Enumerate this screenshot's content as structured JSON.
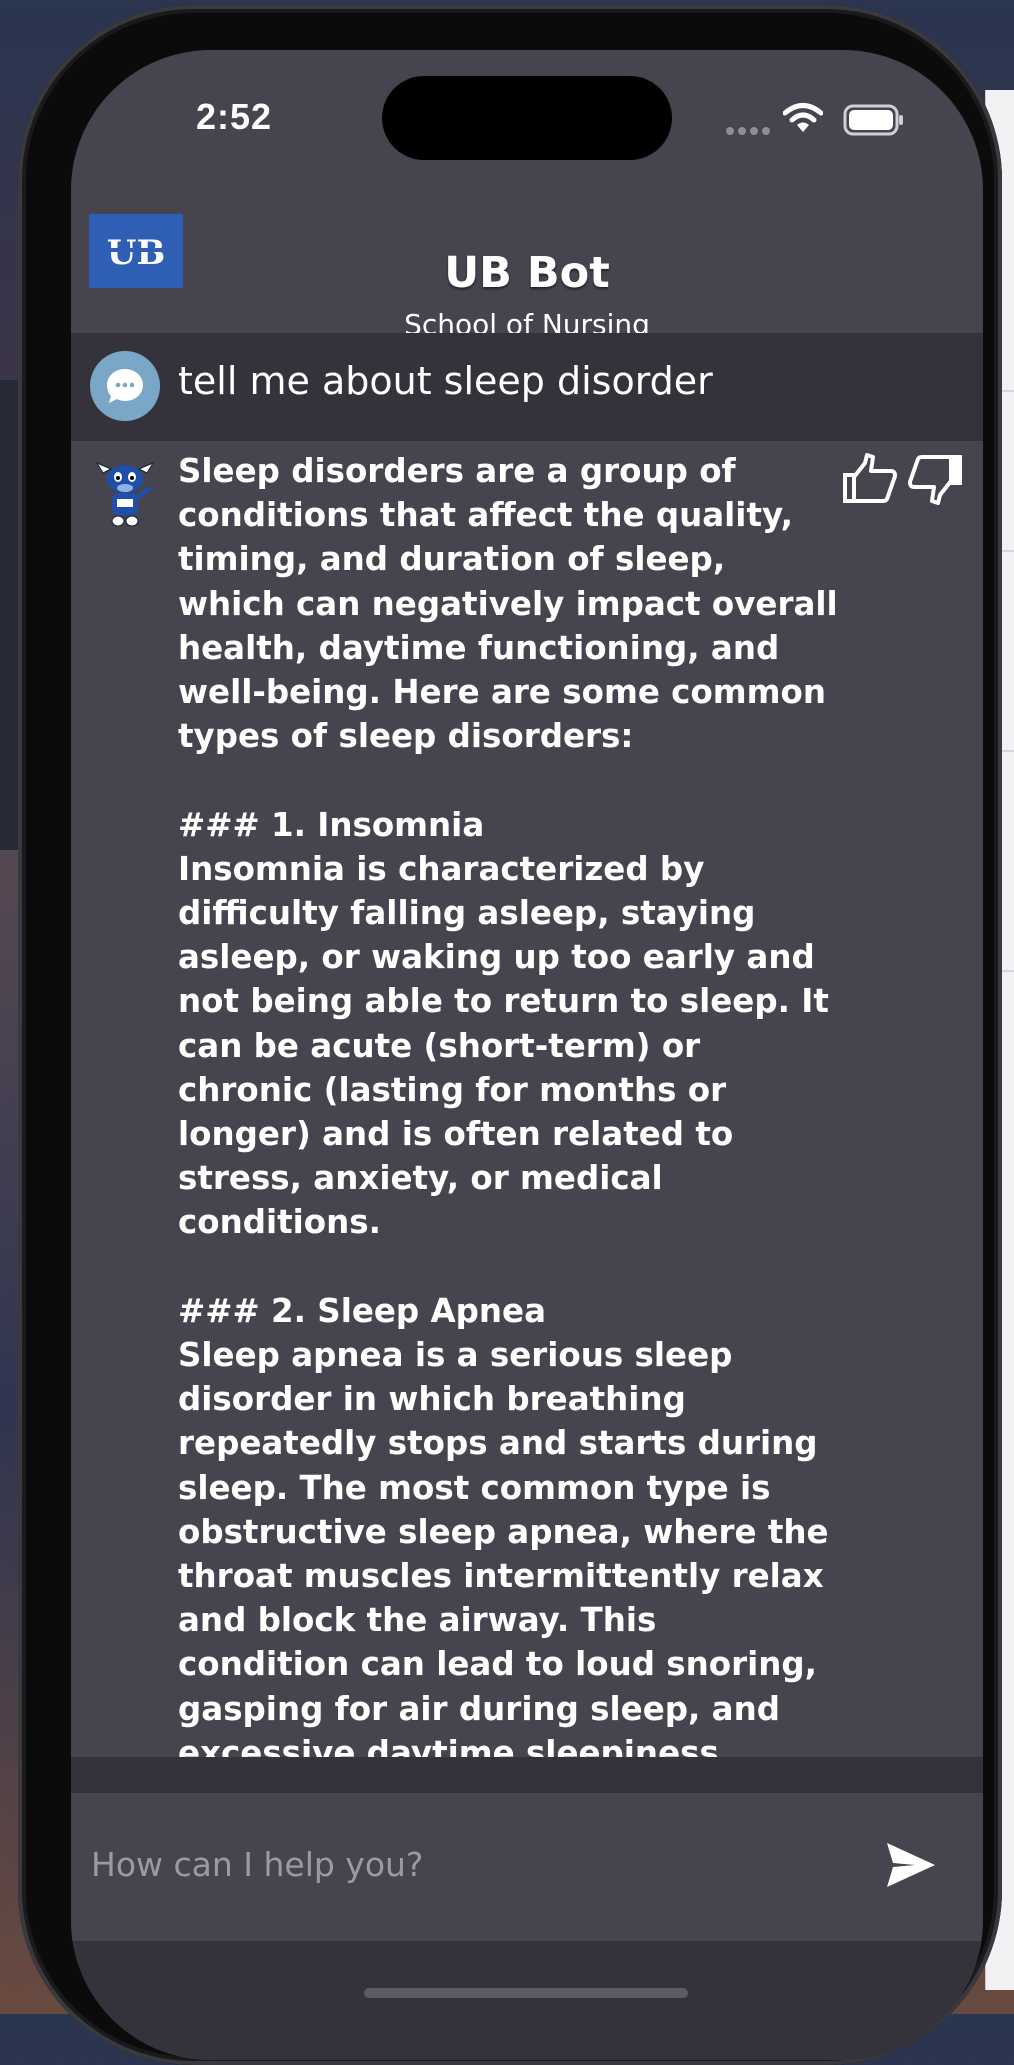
{
  "status_bar": {
    "time": "2:52"
  },
  "header": {
    "title": "UB Bot",
    "subtitle": "School of Nursing",
    "logo_text": "UB"
  },
  "conversation": {
    "user_message": "tell me about sleep disorder",
    "bot_message": "Sleep disorders are a group of\nconditions that affect the quality,\ntiming, and duration of sleep,\nwhich can negatively impact overall\nhealth, daytime functioning, and\nwell-being. Here are some common\ntypes of sleep disorders:\n\n### 1. Insomnia\nInsomnia is characterized by\ndifficulty falling asleep, staying\nasleep, or waking up too early and\nnot being able to return to sleep. It\ncan be acute (short-term) or\nchronic (lasting for months or\nlonger) and is often related to\nstress, anxiety, or medical\nconditions.\n\n### 2. Sleep Apnea\nSleep apnea is a serious sleep\ndisorder in which breathing\nrepeatedly stops and starts during\nsleep. The most common type is\nobstructive sleep apnea, where the\nthroat muscles intermittently relax\nand block the airway. This\ncondition can lead to loud snoring,\ngasping for air during sleep, and\nexcessive daytime sleepiness."
  },
  "input": {
    "placeholder": "How can I help you?"
  },
  "icons": {
    "logo": "ub-logo",
    "user_avatar": "chat-bubble-icon",
    "bot_avatar": "bull-mascot-icon",
    "feedback_positive": "thumbs-up-icon",
    "feedback_negative": "thumbs-down-icon",
    "send": "send-icon"
  },
  "colors": {
    "screen_background": "#45444f",
    "user_row_background": "#34333b",
    "logo_blue": "#2f5fb5",
    "user_avatar": "#7aa6c8",
    "text": "#ffffff",
    "placeholder": "#9a99a4"
  }
}
